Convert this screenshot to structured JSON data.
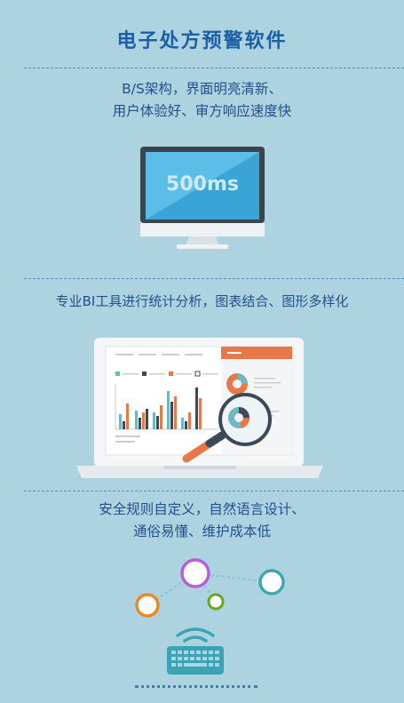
{
  "title": "电子处方预警软件",
  "features": [
    {
      "lines": [
        "B/S架构，界面明亮清新、",
        "用户体验好、审方响应速度快"
      ],
      "monitor_text": "500ms"
    },
    {
      "lines": [
        "专业BI工具进行统计分析，图表结合、图形多样化"
      ]
    },
    {
      "lines": [
        "安全规则自定义，自然语言设计、",
        "通俗易懂、维护成本低"
      ]
    }
  ],
  "colors": {
    "background": "#add3e1",
    "title": "#1b5fa6",
    "text": "#24508a",
    "accent_orange": "#e8784a",
    "accent_teal": "#3ea8b0",
    "accent_purple": "#b560d8",
    "accent_green": "#66a81e"
  }
}
